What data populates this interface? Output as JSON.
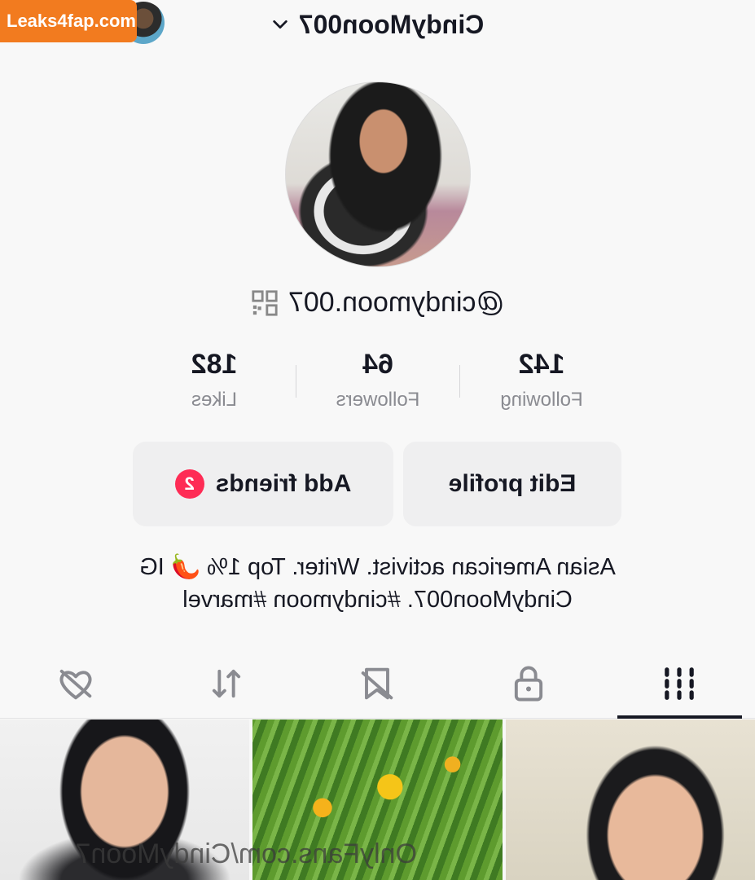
{
  "watermark": {
    "badge_text": "Leaks4fap.com",
    "overlay_text": "OnlyFans.com/CindyMoon7"
  },
  "header": {
    "username": "CindyMoon007",
    "chevron_icon": "chevron-down-icon"
  },
  "profile": {
    "handle": "@cindymoon.007",
    "qr_icon": "qr-code-icon"
  },
  "stats": [
    {
      "value": "142",
      "label": "Following"
    },
    {
      "value": "64",
      "label": "Followers"
    },
    {
      "value": "182",
      "label": "Likes"
    }
  ],
  "buttons": {
    "edit_profile": "Edit profile",
    "add_friends": "Add friends",
    "add_friends_badge": "2"
  },
  "bio": {
    "line1": "Asian American activist. Writer. Top 1% 🌶️ IG",
    "line2": "CindyMoon007. #cindymoon #marvel"
  },
  "tabs": [
    {
      "icon": "grid-videos-icon",
      "active": true
    },
    {
      "icon": "lock-icon",
      "active": false
    },
    {
      "icon": "bookmark-icon",
      "active": false
    },
    {
      "icon": "repost-icon",
      "active": false
    },
    {
      "icon": "liked-heart-icon",
      "active": false
    }
  ],
  "colors": {
    "accent": "#fe2c55",
    "text": "#161823",
    "muted": "#8a8b91",
    "watermark_bg": "#f27b1f"
  }
}
